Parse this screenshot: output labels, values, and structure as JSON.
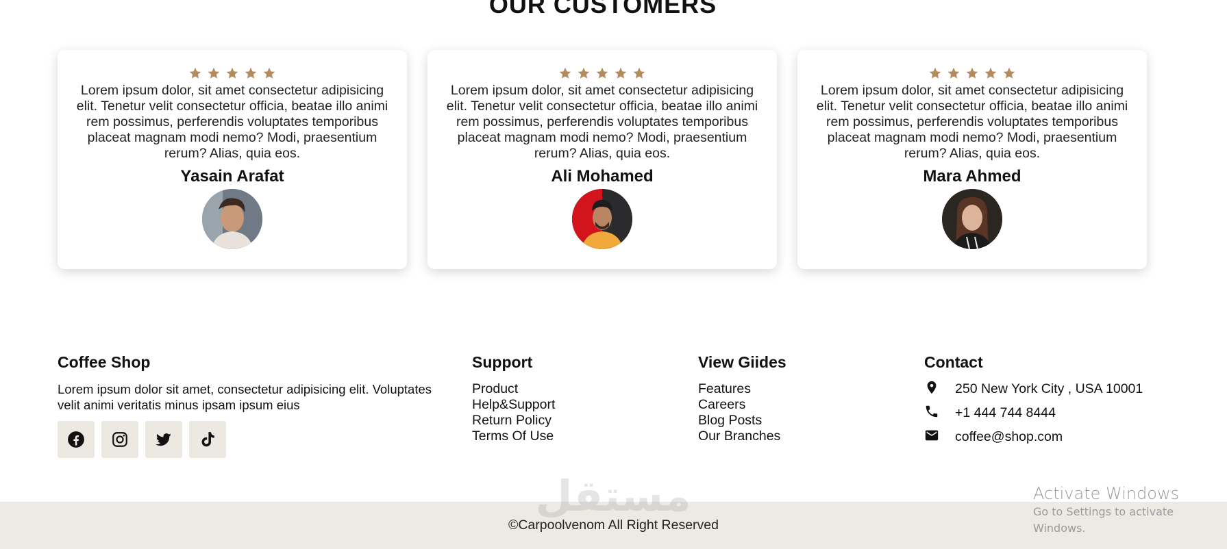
{
  "section": {
    "title": "OUR CUSTOMERS"
  },
  "testimonials": [
    {
      "rating": 5,
      "quote": "Lorem ipsum dolor, sit amet consectetur adipisicing elit. Tenetur velit consectetur officia, beatae illo animi rem possimus, perferendis voluptates temporibus placeat magnam modi nemo? Modi, praesentium rerum? Alias, quia eos.",
      "name": "Yasain Arafat"
    },
    {
      "rating": 5,
      "quote": "Lorem ipsum dolor, sit amet consectetur adipisicing elit. Tenetur velit consectetur officia, beatae illo animi rem possimus, perferendis voluptates temporibus placeat magnam modi nemo? Modi, praesentium rerum? Alias, quia eos.",
      "name": "Ali Mohamed"
    },
    {
      "rating": 5,
      "quote": "Lorem ipsum dolor, sit amet consectetur adipisicing elit. Tenetur velit consectetur officia, beatae illo animi rem possimus, perferendis voluptates temporibus placeat magnam modi nemo? Modi, praesentium rerum? Alias, quia eos.",
      "name": "Mara Ahmed"
    }
  ],
  "footer": {
    "about": {
      "title": "Coffee Shop",
      "text": "Lorem ipsum dolor sit amet, consectetur adipisicing elit. Voluptates velit animi veritatis minus ipsam ipsum eius",
      "socials": [
        "facebook-icon",
        "instagram-icon",
        "twitter-icon",
        "tiktok-icon"
      ]
    },
    "support": {
      "title": "Support",
      "links": [
        "Product",
        "Help&Support",
        "Return Policy",
        "Terms Of Use"
      ]
    },
    "guides": {
      "title": "View Giides",
      "links": [
        "Features",
        "Careers",
        "Blog Posts",
        "Our Branches"
      ]
    },
    "contact": {
      "title": "Contact",
      "address": "250 New York City , USA 10001",
      "phone": "+1 444 744 8444",
      "email": "coffee@shop.com"
    }
  },
  "copyright": "©Carpoolvenom All Right Reserved",
  "watermark": {
    "text": "مستقل"
  },
  "os_overlay": {
    "title": "Activate Windows",
    "subtitle": "Go to Settings to activate Windows."
  },
  "colors": {
    "star": "#b38b5d",
    "social_bg": "#ece8e2",
    "copyright_bg": "#edeae4"
  }
}
